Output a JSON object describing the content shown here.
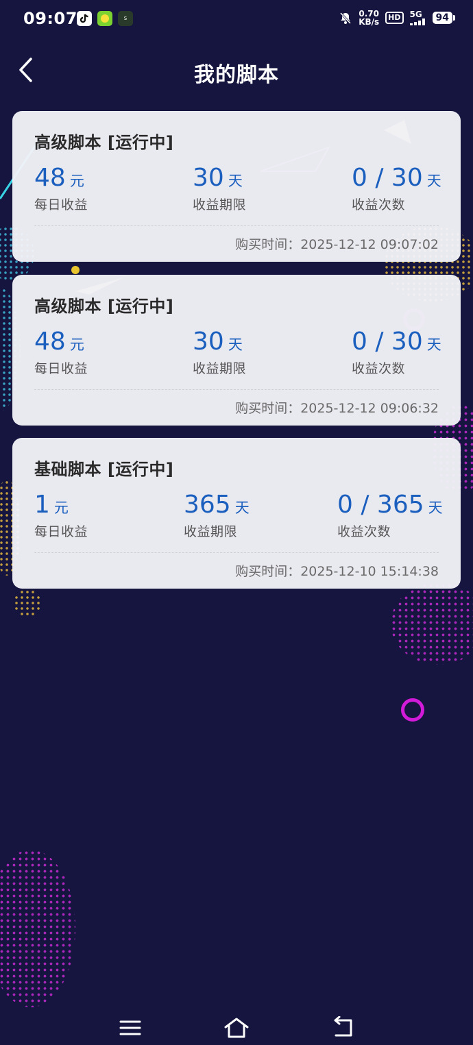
{
  "status_bar": {
    "time": "09:07",
    "net_speed_value": "0.70",
    "net_speed_unit": "KB/s",
    "hd_label": "HD",
    "network_label": "5G",
    "battery_level": "94",
    "app_icons": [
      "tiktok-icon",
      "green-app-icon",
      "soul-app-icon"
    ]
  },
  "header": {
    "title": "我的脚本",
    "back_icon": "chevron-left-icon"
  },
  "cards": [
    {
      "title": "高级脚本 [运行中]",
      "daily_income_value": "48",
      "daily_income_unit": "元",
      "daily_income_label": "每日收益",
      "period_value": "30",
      "period_unit": "天",
      "period_label": "收益期限",
      "count_value": "0 / 30",
      "count_unit": "天",
      "count_label": "收益次数",
      "purchase_time": "购买时间：2025-12-12 09:07:02"
    },
    {
      "title": "高级脚本 [运行中]",
      "daily_income_value": "48",
      "daily_income_unit": "元",
      "daily_income_label": "每日收益",
      "period_value": "30",
      "period_unit": "天",
      "period_label": "收益期限",
      "count_value": "0 / 30",
      "count_unit": "天",
      "count_label": "收益次数",
      "purchase_time": "购买时间：2025-12-12 09:06:32"
    },
    {
      "title": "基础脚本 [运行中]",
      "daily_income_value": "1",
      "daily_income_unit": "元",
      "daily_income_label": "每日收益",
      "period_value": "365",
      "period_unit": "天",
      "period_label": "收益期限",
      "count_value": "0 / 365",
      "count_unit": "天",
      "count_label": "收益次数",
      "purchase_time": "购买时间：2025-12-10 15:14:38"
    }
  ],
  "nav_bar": {
    "icons": [
      "menu-icon",
      "home-icon",
      "back-icon"
    ]
  },
  "colors": {
    "background": "#15153f",
    "accent_value": "#1b5fbe",
    "card_bg": "#f2f2f8"
  }
}
